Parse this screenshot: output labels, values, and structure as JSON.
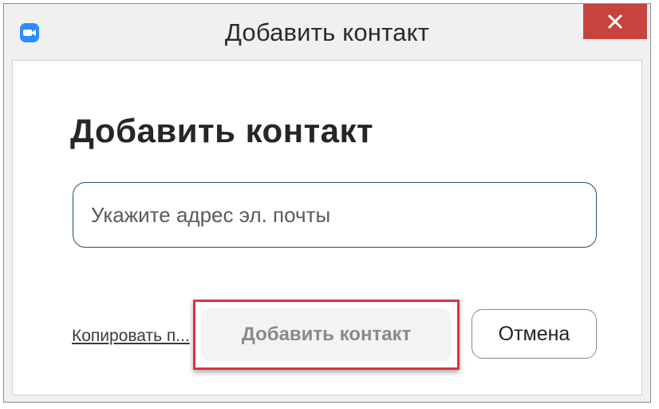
{
  "window": {
    "title": "Добавить контакт",
    "icon": "zoom-video-camera-icon",
    "close_icon": "close-x-icon",
    "accent_color": "#2d8cff",
    "close_color": "#c7433f"
  },
  "dialog": {
    "heading": "Добавить контакт",
    "email_placeholder": "Укажите адрес эл. почты",
    "email_value": "",
    "copy_link_label": "Копировать п...",
    "add_button_label": "Добавить контакт",
    "add_button_state": "disabled",
    "cancel_button_label": "Отмена",
    "highlight_color": "#d9363e"
  }
}
